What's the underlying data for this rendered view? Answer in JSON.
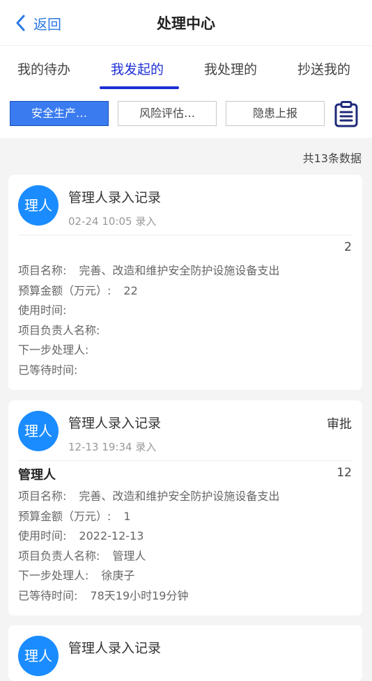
{
  "header": {
    "back_label": "返回",
    "title": "处理中心"
  },
  "tabs": [
    {
      "label": "我的待办",
      "active": false
    },
    {
      "label": "我发起的",
      "active": true
    },
    {
      "label": "我处理的",
      "active": false
    },
    {
      "label": "抄送我的",
      "active": false
    }
  ],
  "filters": [
    {
      "label": "安全生产…",
      "active": true
    },
    {
      "label": "风险评估…",
      "active": false
    },
    {
      "label": "隐患上报",
      "active": false
    }
  ],
  "count_text": "共13条数据",
  "colors": {
    "accent": "#1d2fd6",
    "avatar": "#1a8cff",
    "filter_active": "#3a7bef"
  },
  "cards": [
    {
      "avatar": "理人",
      "title": "管理人录入记录",
      "time": "02-24 10:05 录入",
      "action": "",
      "name": "",
      "number": "2",
      "fields": [
        {
          "label": "项目名称:",
          "value": "完善、改造和维护安全防护设施设备支出"
        },
        {
          "label": "预算金额（万元）:",
          "value": "22"
        },
        {
          "label": "使用时间:",
          "value": ""
        },
        {
          "label": "项目负责人名称:",
          "value": ""
        },
        {
          "label": "下一步处理人:",
          "value": ""
        },
        {
          "label": "已等待时间:",
          "value": ""
        }
      ]
    },
    {
      "avatar": "理人",
      "title": "管理人录入记录",
      "time": "12-13 19:34 录入",
      "action": "审批",
      "name": "管理人",
      "number": "12",
      "fields": [
        {
          "label": "项目名称:",
          "value": "完善、改造和维护安全防护设施设备支出"
        },
        {
          "label": "预算金额（万元）:",
          "value": "1"
        },
        {
          "label": "使用时间:",
          "value": "2022-12-13"
        },
        {
          "label": "项目负责人名称:",
          "value": "管理人"
        },
        {
          "label": "下一步处理人:",
          "value": "徐庚子"
        },
        {
          "label": "已等待时间:",
          "value": "78天19小时19分钟"
        }
      ]
    },
    {
      "avatar": "理人",
      "title": "管理人录入记录"
    }
  ]
}
